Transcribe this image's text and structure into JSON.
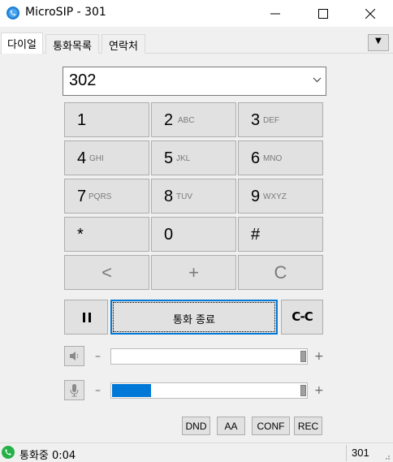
{
  "window": {
    "title": "MicroSIP - 301"
  },
  "tabs": [
    {
      "label": "다이얼",
      "active": true
    },
    {
      "label": "통화목록",
      "active": false
    },
    {
      "label": "연락처",
      "active": false
    }
  ],
  "tabs_menu_glyph": "▼",
  "dialer": {
    "number_value": "302",
    "keys": [
      {
        "digit": "1",
        "letters": ""
      },
      {
        "digit": "2",
        "letters": "ABC"
      },
      {
        "digit": "3",
        "letters": "DEF"
      },
      {
        "digit": "4",
        "letters": "GHI"
      },
      {
        "digit": "5",
        "letters": "JKL"
      },
      {
        "digit": "6",
        "letters": "MNO"
      },
      {
        "digit": "7",
        "letters": "PQRS"
      },
      {
        "digit": "8",
        "letters": "TUV"
      },
      {
        "digit": "9",
        "letters": "WXYZ"
      },
      {
        "digit": "*",
        "letters": ""
      },
      {
        "digit": "0",
        "letters": ""
      },
      {
        "digit": "#",
        "letters": ""
      }
    ],
    "controls": {
      "backspace": "<",
      "plus": "+",
      "clear": "C"
    }
  },
  "call_buttons": {
    "end_call_label": "통화 종료",
    "transfer_label": "C-C"
  },
  "volume": {
    "minus_symbol": "–",
    "plus_symbol": "+",
    "speaker_level": 1.0,
    "microphone_level": 0.2
  },
  "feature_buttons": [
    "DND",
    "AA",
    "CONF",
    "REC"
  ],
  "status": {
    "text": "통화중 0:04",
    "account": "301"
  },
  "colors": {
    "accent": "#0078d7",
    "status_green": "#25b148",
    "app_icon_blue": "#1f7fd6"
  },
  "icons": {
    "app": "microsip-phone-icon",
    "hold": "pause-icon",
    "speaker": "speaker-icon",
    "microphone": "microphone-icon",
    "status": "call-active-icon"
  }
}
